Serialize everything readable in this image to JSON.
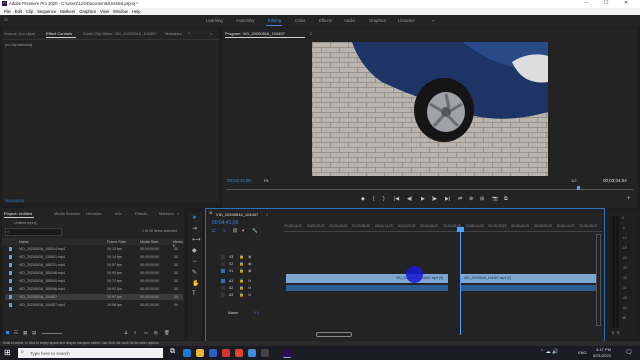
{
  "window": {
    "title": "Adobe Premiere Pro 2020 - C:\\Users\\123\\Documents\\Untitled.prproj *",
    "controls": [
      "–",
      "☐",
      "✕"
    ]
  },
  "menu": [
    "File",
    "Edit",
    "Clip",
    "Sequence",
    "Markers",
    "Graphics",
    "View",
    "Window",
    "Help"
  ],
  "workspaces": {
    "items": [
      "Learning",
      "Assembly",
      "Editing",
      "Color",
      "Effects",
      "Audio",
      "Graphics",
      "Libraries"
    ],
    "active": "Editing",
    "more": "»"
  },
  "source_panel": {
    "tabs": [
      "Source: (no clips)",
      "Effect Controls",
      "Audio Clip Mixer: VID_20200516_104457",
      "Metadata"
    ],
    "active_tab": "Effect Controls",
    "menu_glyph": "≡",
    "more": "»",
    "empty_text": "(no clip selected)",
    "bottom_timecode": "00;00;00;00"
  },
  "program_monitor": {
    "title": "Program: VID_20200516_104457",
    "menu_glyph": "≡",
    "timecode_left": "00;04;41;00",
    "fit": "Fit",
    "resolution": "1/2",
    "timecode_right": "00;03;04;04",
    "transport": [
      "◆",
      "|",
      "{",
      "}",
      "|◀",
      "◀|",
      "▶",
      "|▶",
      "▶|",
      "⇄",
      "⊕",
      "⊞",
      "📷",
      "⧉"
    ]
  },
  "project_panel": {
    "tabs": [
      "Project: Untitled",
      "Media Browser",
      "Libraries",
      "Info",
      "Effects",
      "Markers"
    ],
    "active_tab": "Project: Untitled",
    "more": "»",
    "menu_glyph": "≡",
    "project_file": "Untitled.prproj",
    "items_selected": "1 of 16 items selected",
    "search_placeholder": "",
    "columns": [
      "Name",
      "Frame Rate",
      "Media Start",
      "Media E"
    ],
    "rows": [
      {
        "name": "VID_20200516_100914.mp4",
        "fps": "29.13 fps",
        "start": "00;00;00;00",
        "end": "00"
      },
      {
        "name": "VID_20200516_133601.mp4",
        "fps": "29.14 fps",
        "start": "00;00;00;00",
        "end": "00"
      },
      {
        "name": "VID_20200516_185231.mp4",
        "fps": "29.57 fps",
        "start": "00;00;00;00",
        "end": "00"
      },
      {
        "name": "VID_20200516_185246.mp4",
        "fps": "29.93 fps",
        "start": "00;00;00;00",
        "end": "00"
      },
      {
        "name": "VID_20200516_185540.mp4",
        "fps": "29.72 fps",
        "start": "00;00;00;00",
        "end": "00"
      },
      {
        "name": "VID_20200516_185546.mp4",
        "fps": "29.92 fps",
        "start": "00;00;00;00",
        "end": "00"
      },
      {
        "name": "VID_20200516_104457",
        "fps": "29.97 fps",
        "start": "00;00;00;00",
        "end": "00"
      },
      {
        "name": "VID_20200516_104457.mp4",
        "fps": "29.98 fps",
        "start": "00;00;00;00",
        "end": "00"
      }
    ],
    "selected_row": 6
  },
  "timeline": {
    "sequence_tab": "VID_20200516_104457",
    "menu_glyph": "≡",
    "timecode": "00;04;41;00",
    "ruler": [
      "00;03;14;29",
      "00;03;29;29",
      "00;03;44;29",
      "00;03;59;29",
      "00;04;14;29",
      "00;04;29;29",
      "00;04;44;29",
      "00;04;59;29",
      "00;05;14;29",
      "00;05;29;29",
      "00;05;44;29",
      "00;05;59;29",
      "00;06;14;29",
      "00;06;29;29"
    ],
    "tracks": [
      "V3",
      "V2",
      "V1",
      "A1",
      "A2",
      "A3"
    ],
    "master": "Master",
    "master_value": "0.0",
    "clip_label_1": "VID_20200516_104457.mp4 [V]",
    "clip_label_2": "VID_20200516_104457.mp4 [V]",
    "meter_labels": [
      "0",
      "-6",
      "-12",
      "-18",
      "-24",
      "-30",
      "-36",
      "-42",
      "-48",
      "-54",
      "dB"
    ],
    "meter_solo": [
      "S",
      "S"
    ]
  },
  "status_bar": {
    "text": "Click to select, or click in empty space and drag to marquee select. Use Shift, Alt, and Ctrl for other options."
  },
  "taskbar": {
    "search_placeholder": "Type here to search",
    "time": "4:47 PM",
    "date": "5/21/2020",
    "language": "ENG"
  },
  "colors": {
    "accent": "#2d8ceb",
    "video_clip": "#7fa6d2",
    "audio_clip": "#2e5d96",
    "playhead": "#4aa3ff"
  }
}
